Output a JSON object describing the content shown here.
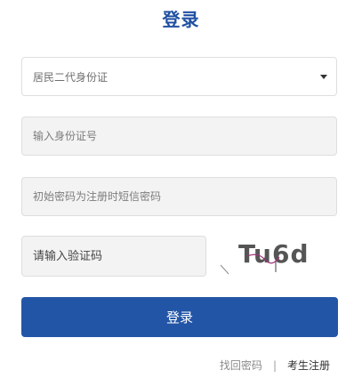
{
  "title": "登录",
  "id_type_select": {
    "selected": "居民二代身份证"
  },
  "id_number": {
    "placeholder": "输入身份证号",
    "value": ""
  },
  "password": {
    "placeholder": "初始密码为注册时短信密码",
    "value": ""
  },
  "captcha": {
    "placeholder": "请输入验证码",
    "value": "",
    "image_text": "Tu6d"
  },
  "login_button": "登录",
  "links": {
    "forgot_password": "找回密码",
    "separator": "|",
    "register": "考生注册"
  },
  "colors": {
    "brand_blue": "#2355a7",
    "title_blue": "#1f50a2"
  }
}
